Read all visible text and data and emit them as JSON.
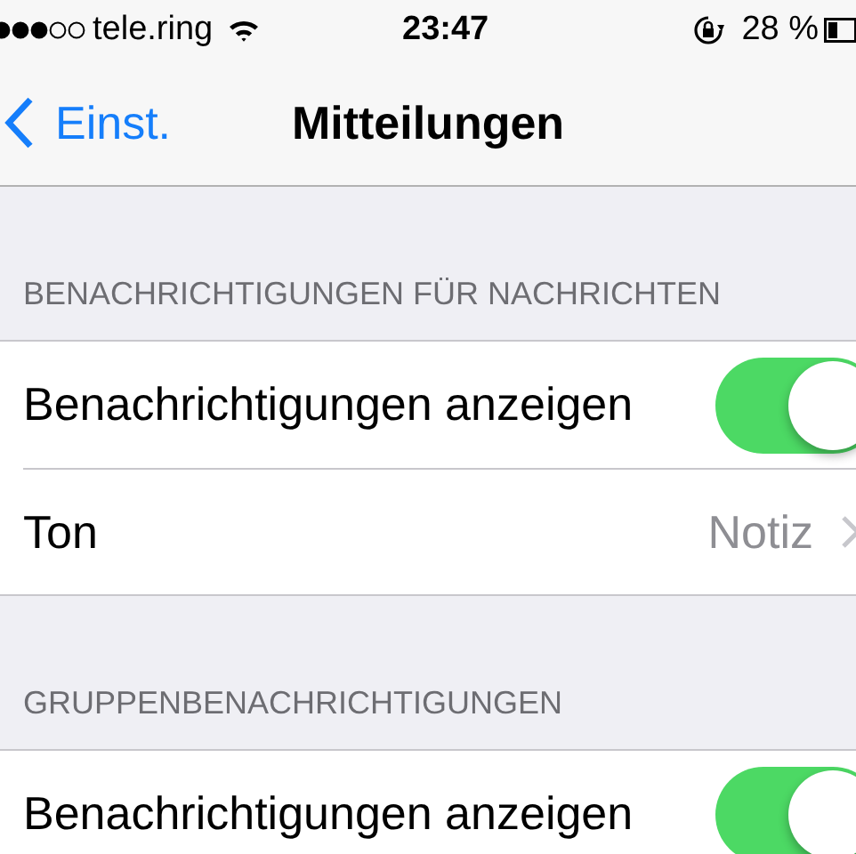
{
  "status_bar": {
    "carrier": "tele.ring",
    "time": "23:47",
    "battery": "28 %"
  },
  "nav_bar": {
    "back": "Einst.",
    "title": "Mitteilungen"
  },
  "sections": [
    {
      "header": "BENACHRICHTIGUNGEN FÜR NACHRICHTEN",
      "rows": [
        {
          "kind": "switch",
          "label": "Benachrichtigungen anzeigen",
          "on": true
        },
        {
          "kind": "disclosure",
          "label": "Ton",
          "value": "Notiz"
        }
      ]
    },
    {
      "header": "GRUPPENBENACHRICHTIGUNGEN",
      "rows": [
        {
          "kind": "switch",
          "label": "Benachrichtigungen anzeigen",
          "on": true
        }
      ]
    }
  ]
}
